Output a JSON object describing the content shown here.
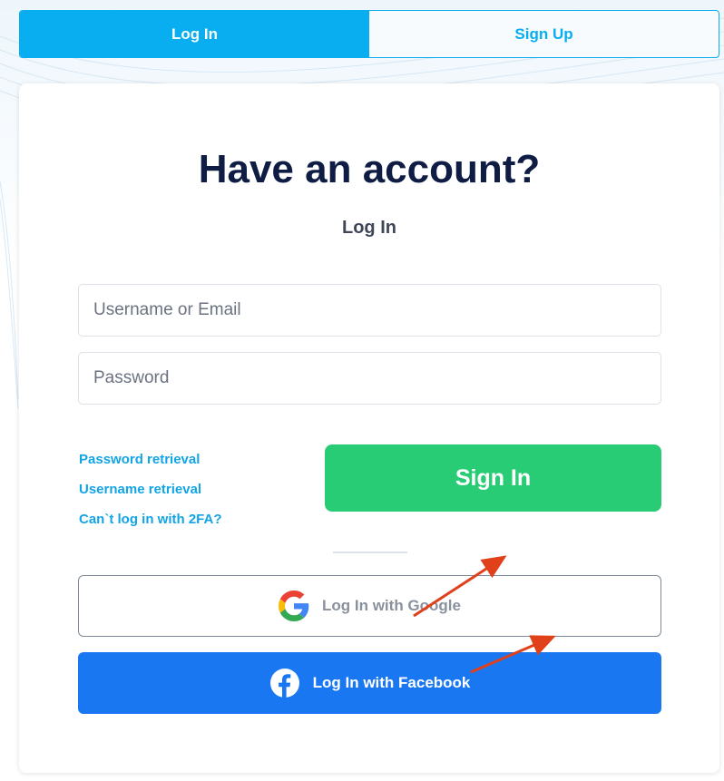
{
  "tabs": {
    "login_label": "Log In",
    "signup_label": "Sign Up"
  },
  "card": {
    "heading": "Have an account?",
    "subheading": "Log In"
  },
  "form": {
    "username_placeholder": "Username or Email",
    "username_value": "",
    "password_placeholder": "Password",
    "password_value": ""
  },
  "links": {
    "password_retrieval": "Password retrieval",
    "username_retrieval": "Username retrieval",
    "cant_login_2fa": "Can`t log in with 2FA?"
  },
  "buttons": {
    "sign_in": "Sign In",
    "google": "Log In with Google",
    "facebook": "Log In with Facebook"
  },
  "icons": {
    "google": "google-logo-icon",
    "facebook": "facebook-logo-icon"
  },
  "colors": {
    "accent": "#08aef0",
    "sign_in": "#28cc74",
    "facebook": "#1977f2",
    "heading": "#0f1d45",
    "link": "#13a4e6",
    "annotation_arrow": "#e0401a"
  }
}
